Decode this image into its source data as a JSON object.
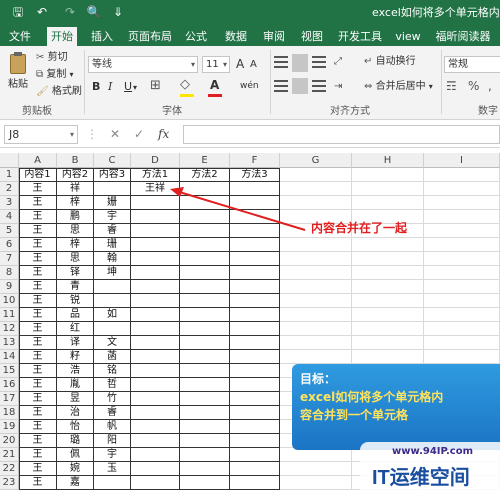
{
  "title_bar": {
    "document_title": "excel如何将多个单元格内容合",
    "save_glyph": "🖫",
    "undo_glyph": "↶",
    "redo_glyph": "↷",
    "print_preview_glyph": "🔍",
    "customize_glyph": "⇓"
  },
  "tabs": [
    "文件",
    "开始",
    "插入",
    "页面布局",
    "公式",
    "数据",
    "审阅",
    "视图",
    "开发工具",
    "view",
    "福昕阅读器"
  ],
  "active_tab": "开始",
  "ribbon": {
    "clipboard": {
      "paste": "粘贴",
      "cut": "剪切",
      "copy": "复制",
      "copy_dd": "▾",
      "format_painter": "格式刷",
      "group_label": "剪贴板"
    },
    "font": {
      "font_name": "等线",
      "font_size": "11",
      "grow": "A",
      "shrink": "A",
      "bold": "B",
      "italic": "I",
      "underline": "U",
      "underline_dd": "▾",
      "borders": "⊞",
      "fill": "◇",
      "font_color": "A",
      "phonetic": "wén",
      "group_label": "字体"
    },
    "alignment": {
      "wrap_text": "自动换行",
      "merge_center": "合并后居中",
      "merge_dd": "▾",
      "group_label": "对齐方式"
    },
    "number": {
      "format": "常规",
      "currency": "☶",
      "percent": "%",
      "comma": ",",
      "group_label": "数字"
    },
    "colors": {
      "accent": "#217346",
      "fill_color": "#ffe600",
      "font_color": "#e02020"
    }
  },
  "formula_bar": {
    "name_box": "J8",
    "cancel": "✕",
    "enter": "✓",
    "fx": "fx"
  },
  "sheet": {
    "columns": [
      "A",
      "B",
      "C",
      "D",
      "E",
      "F",
      "G",
      "H",
      "I"
    ],
    "rows": [
      [
        "内容1",
        "内容2",
        "内容3",
        "方法1",
        "方法2",
        "方法3"
      ],
      [
        "王",
        "祥",
        "",
        "王祥",
        "",
        ""
      ],
      [
        "王",
        "梓",
        "姗",
        "",
        "",
        ""
      ],
      [
        "王",
        "鹏",
        "宇",
        "",
        "",
        ""
      ],
      [
        "王",
        "思",
        "睿",
        "",
        "",
        ""
      ],
      [
        "王",
        "梓",
        "珊",
        "",
        "",
        ""
      ],
      [
        "王",
        "思",
        "翰",
        "",
        "",
        ""
      ],
      [
        "王",
        "铎",
        "坤",
        "",
        "",
        ""
      ],
      [
        "王",
        "青",
        "",
        "",
        "",
        ""
      ],
      [
        "王",
        "锐",
        "",
        "",
        "",
        ""
      ],
      [
        "王",
        "品",
        "如",
        "",
        "",
        ""
      ],
      [
        "王",
        "红",
        "",
        "",
        "",
        ""
      ],
      [
        "王",
        "译",
        "文",
        "",
        "",
        ""
      ],
      [
        "王",
        "籽",
        "菡",
        "",
        "",
        ""
      ],
      [
        "王",
        "浩",
        "铭",
        "",
        "",
        ""
      ],
      [
        "王",
        "胤",
        "哲",
        "",
        "",
        ""
      ],
      [
        "王",
        "昱",
        "竹",
        "",
        "",
        ""
      ],
      [
        "王",
        "治",
        "睿",
        "",
        "",
        ""
      ],
      [
        "王",
        "怡",
        "帆",
        "",
        "",
        ""
      ],
      [
        "王",
        "璐",
        "阳",
        "",
        "",
        ""
      ],
      [
        "王",
        "佩",
        "宇",
        "",
        "",
        ""
      ],
      [
        "王",
        "婉",
        "玉",
        "",
        "",
        ""
      ],
      [
        "王",
        "嘉",
        "",
        "",
        "",
        ""
      ]
    ]
  },
  "annotation": {
    "text": "内容合并在了一起",
    "color": "#e02020"
  },
  "banner": {
    "line1": "目标：",
    "line2": "excel如何将多个单元格内",
    "line3": "容合并到一个单元格"
  },
  "watermark": {
    "url": "www.94IP.com",
    "brand": "IT运维空间"
  }
}
